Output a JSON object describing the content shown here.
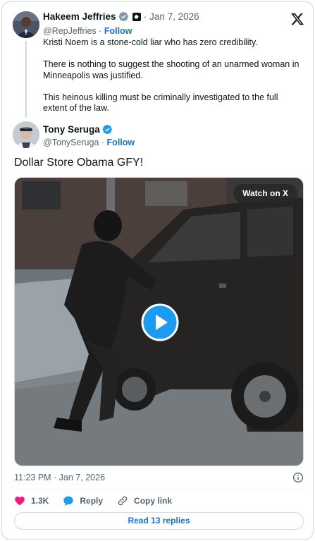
{
  "quoted_tweet": {
    "author_name": "Hakeem Jeffries",
    "handle": "@RepJeffries",
    "follow_label": "Follow",
    "separator": "·",
    "date": "Jan 7, 2026",
    "paragraphs": [
      "Kristi Noem is a stone-cold liar who has zero credibility.",
      "There is nothing to suggest the shooting of an unarmed woman in Minneapolis was justified.",
      "This heinous killing must be criminally investigated to the full extent of the law."
    ]
  },
  "tweet": {
    "author_name": "Tony Seruga",
    "handle": "@TonySeruga",
    "follow_label": "Follow",
    "separator": "·",
    "text": "Dollar Store Obama GFY!",
    "timestamp": "11:23 PM · Jan 7, 2026"
  },
  "video": {
    "watch_label": "Watch on X"
  },
  "actions": {
    "like_count": "1.3K",
    "reply_label": "Reply",
    "copy_link_label": "Copy link",
    "read_replies_label": "Read 13 replies"
  },
  "icons": {
    "platform": "x-logo-icon",
    "verified": "verified-badge-icon",
    "gov": "government-badge-icon",
    "play": "play-icon",
    "info": "info-icon",
    "like": "heart-icon",
    "reply": "reply-bubble-icon",
    "link": "link-icon"
  },
  "colors": {
    "accent": "#1d9bf0",
    "link": "#1d6fc7",
    "like": "#f91880",
    "text": "#0f1419",
    "muted": "#536471"
  }
}
